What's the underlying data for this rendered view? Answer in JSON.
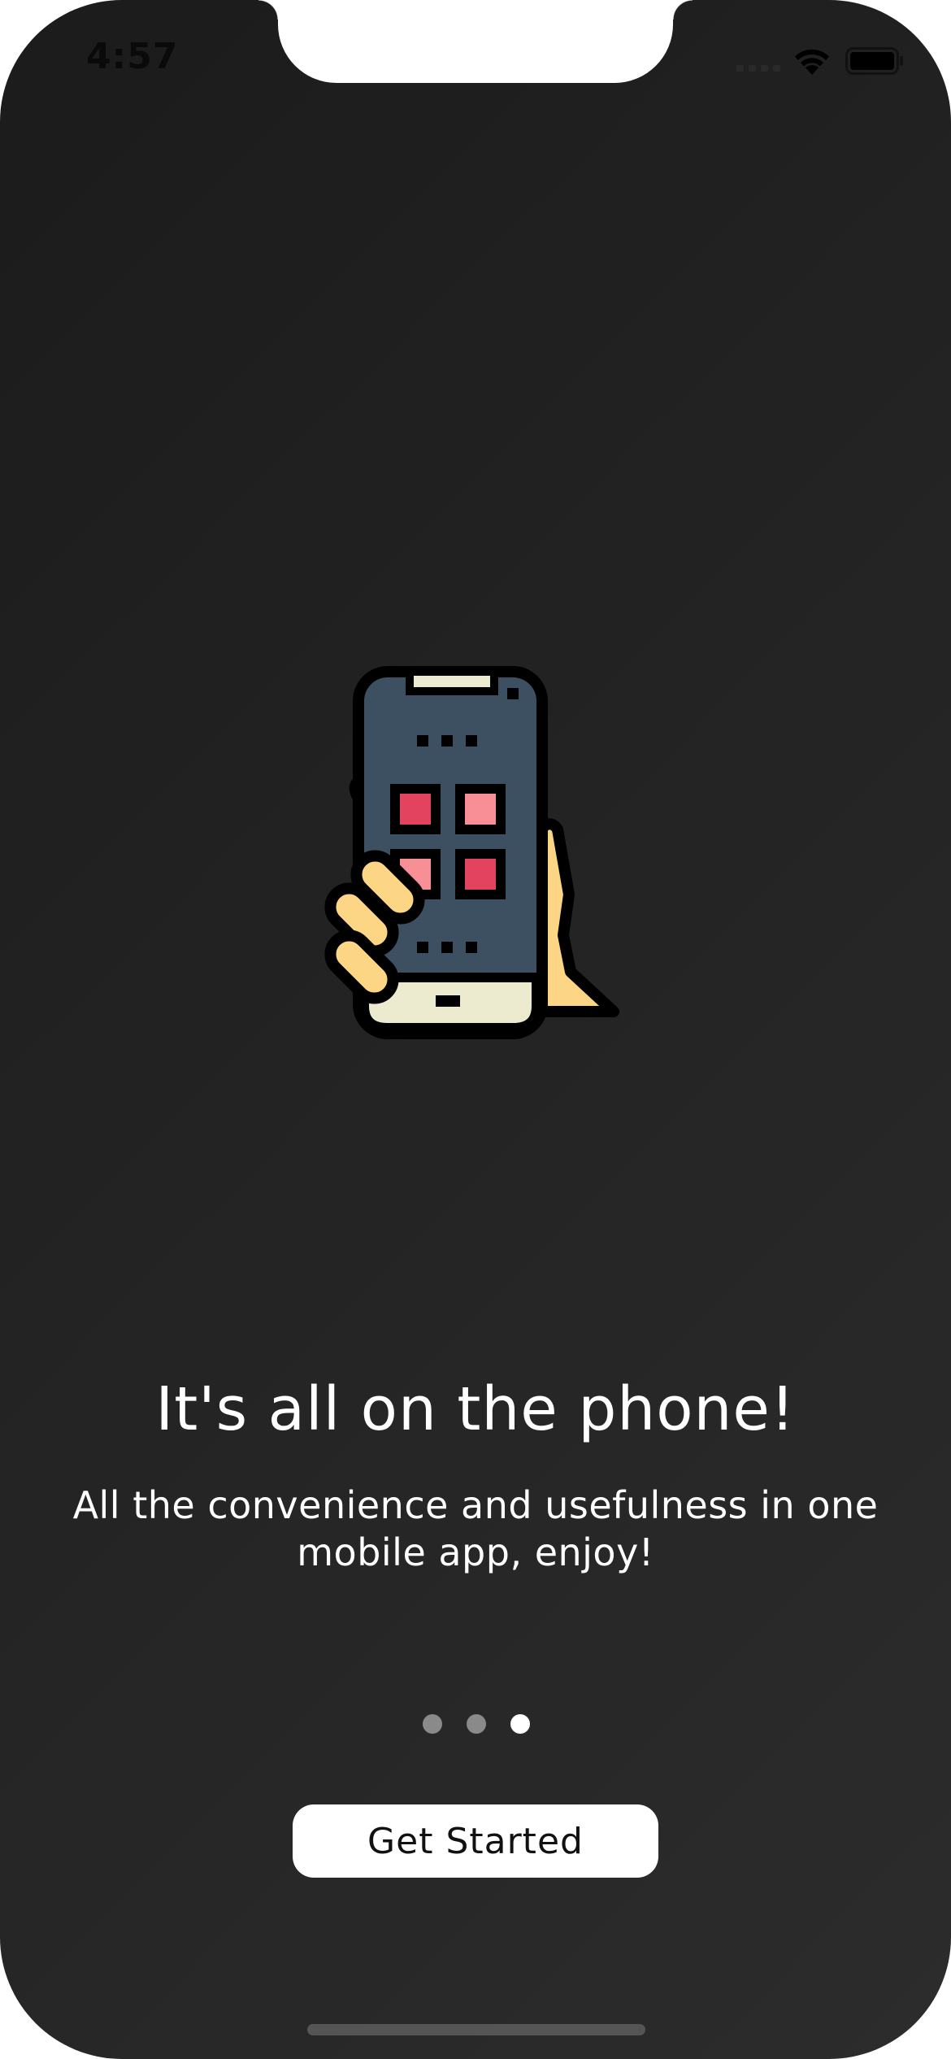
{
  "status_bar": {
    "time": "4:57",
    "signal_icon": "cellular-signal-icon",
    "wifi_icon": "wifi-icon",
    "battery_icon": "battery-full-icon"
  },
  "onboarding": {
    "illustration_icon": "hand-holding-phone-icon",
    "headline": "It's all on the phone!",
    "subtitle": "All the convenience and usefulness in one mobile app, enjoy!",
    "page_count": 3,
    "active_page": 3,
    "button_label": "Get Started"
  },
  "colors": {
    "background_dark": "#1e1e1e",
    "text": "#ffffff",
    "dot_inactive": "#8a8a8a",
    "dot_active": "#ffffff",
    "button_bg": "#ffffff",
    "illustration_screen": "#3c5062",
    "illustration_hand": "#fdd685",
    "illustration_app_red": "#e3435f",
    "illustration_app_pink": "#f88e96",
    "illustration_bezel_cream": "#ecebd0"
  }
}
